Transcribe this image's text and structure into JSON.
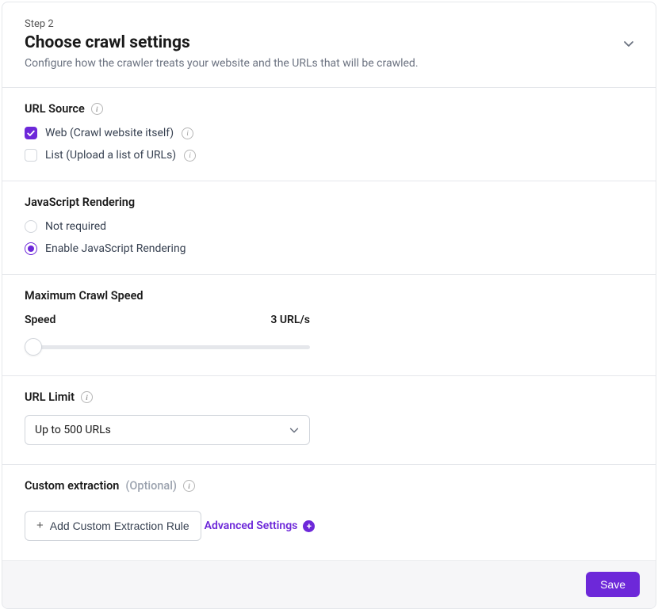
{
  "header": {
    "step_label": "Step 2",
    "title": "Choose crawl settings",
    "subtitle": "Configure how the crawler treats your website and the URLs that will be crawled."
  },
  "url_source": {
    "title": "URL Source",
    "options": {
      "web": "Web (Crawl website itself)",
      "list": "List (Upload a list of URLs)"
    }
  },
  "js_rendering": {
    "title": "JavaScript Rendering",
    "options": {
      "not_required": "Not required",
      "enable": "Enable JavaScript Rendering"
    }
  },
  "crawl_speed": {
    "title": "Maximum Crawl Speed",
    "label": "Speed",
    "value": "3 URL/s"
  },
  "url_limit": {
    "title": "URL Limit",
    "selected": "Up to 500 URLs"
  },
  "custom_extraction": {
    "title": "Custom extraction",
    "optional_label": "(Optional)",
    "button_label": "Add Custom Extraction Rule"
  },
  "advanced": {
    "label": "Advanced Settings"
  },
  "footer": {
    "save_label": "Save"
  }
}
